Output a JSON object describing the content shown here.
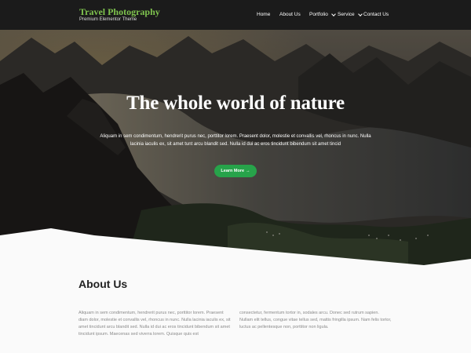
{
  "site": {
    "title": "Travel Photography",
    "tagline": "Premium Elementor Theme"
  },
  "nav": [
    {
      "label": "Home"
    },
    {
      "label": "About Us"
    },
    {
      "label": "Portfolio"
    },
    {
      "label": "Service"
    },
    {
      "label": "Contact Us"
    }
  ],
  "hero": {
    "title": "The whole world of nature",
    "text": "Aliquam in sem condimentum, hendrerit purus nec, porttitor lorem. Praesent dolor, molestie et convallis vel, rhoncus in nunc. Nulla lacinia iaculis ex, sit amet tunt arcu blandit sed. Nulla id dui ac eros tincidunt bibendum sit amet tincid",
    "button_label": "Learn More",
    "button_arrow": "→"
  },
  "about": {
    "title": "About Us",
    "col1": "Aliquam in sem condimentum, hendrerit purus nec, porttitor lorem. Praesent diam dolor, molestie et convallis vel, rhoncus in nunc. Nulla lacinia iaculis ex, sit amet tincidunt arcu blandit sed. Nulla id dui ac eros tincidunt bibendum sit amet tincidunt ipsum. Maecenas sed viverra lorem. Quisque quis est",
    "col2": "consectetur, fermentum tortor in, sodales arcu. Donec sed rutrum sapien. Nullam elit tellus, congue vitae tellus sed, mattis fringilla ipsum. Nam felis tortor, luctus ac pellentesque non, porttitor non ligula."
  },
  "colors": {
    "header_bg": "#1b1b1b",
    "brand": "#7fc34e",
    "button": "#27a34a",
    "page_bg": "#fafafa"
  }
}
